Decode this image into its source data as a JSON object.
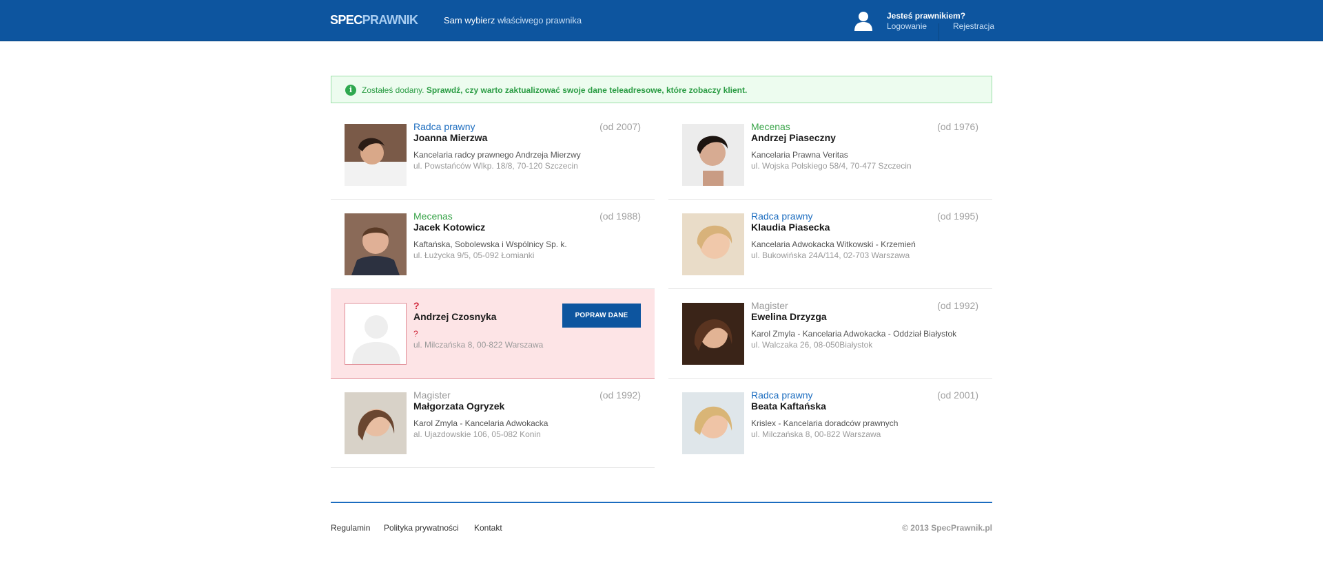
{
  "header": {
    "logo_a": "SPEC",
    "logo_b": "PRAWNIK",
    "tagline_bold": "Sam wybierz",
    "tagline_rest": " właściwego prawnika",
    "account_question": "Jesteś prawnikiem?",
    "login": "Logowanie",
    "register": "Rejestracja"
  },
  "notice": {
    "icon": "i",
    "lead": "Zostałeś dodany.",
    "message": " Sprawdź, czy warto zaktualizować swoje dane teleadresowe, które zobaczy klient."
  },
  "lawyers": [
    {
      "title": "Radca prawny",
      "since": "(od 2007)",
      "name": "Joanna Mierzwa",
      "firm": "Kancelaria radcy prawnego Andrzeja Mierzwy",
      "address": "ul. Powstańców Wlkp. 18/8, 70-120 Szczecin"
    },
    {
      "title": "Mecenas",
      "since": "(od 1976)",
      "name": "Andrzej Piaseczny",
      "firm": "Kancelaria Prawna Veritas",
      "address": "ul. Wojska Polskiego 58/4, 70-477 Szczecin"
    },
    {
      "title": "Mecenas",
      "since": "(od 1988)",
      "name": "Jacek Kotowicz",
      "firm": "Kaftańska, Sobolewska i Wspólnicy Sp. k.",
      "address": "ul. Łużycka 9/5, 05-092 Łomianki"
    },
    {
      "title": "Radca prawny",
      "since": "(od 1995)",
      "name": "Klaudia Piasecka",
      "firm": "Kancelaria Adwokacka Witkowski - Krzemień",
      "address": "ul. Bukowińska 24A/114, 02-703 Warszawa"
    },
    {
      "title": "?",
      "since": "",
      "name": "Andrzej Czosnyka",
      "firm": "?",
      "address": "ul. Milczańska 8, 00-822 Warszawa",
      "button": "POPRAW DANE"
    },
    {
      "title": "Magister",
      "since": "(od 1992)",
      "name": "Ewelina Drzyzga",
      "firm": "Karol Zmyla - Kancelaria Adwokacka - Oddział Białystok",
      "address": "ul. Walczaka 26, 08-050Białystok"
    },
    {
      "title": "Magister",
      "since": "(od 1992)",
      "name": "Małgorzata Ogryzek",
      "firm": "Karol Zmyla - Kancelaria Adwokacka",
      "address": "al. Ujazdowskie 106, 05-082 Konin"
    },
    {
      "title": "Radca prawny",
      "since": "(od 2001)",
      "name": "Beata Kaftańska",
      "firm": "Krislex - Kancelaria doradców prawnych",
      "address": "ul. Milczańska 8, 00-822 Warszawa"
    }
  ],
  "footer": {
    "links": [
      "Regulamin",
      "Polityka prywatności",
      "Kontakt"
    ],
    "copyright": "© 2013 SpecPrawnik.pl"
  }
}
